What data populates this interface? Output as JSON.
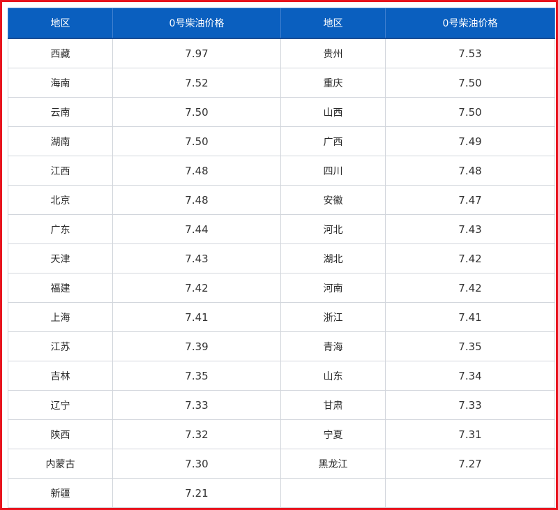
{
  "header": {
    "region_label": "地区",
    "price_label": "0号柴油价格"
  },
  "rows": [
    {
      "left": {
        "region": "西藏",
        "price": "7.97"
      },
      "right": {
        "region": "贵州",
        "price": "7.53"
      }
    },
    {
      "left": {
        "region": "海南",
        "price": "7.52"
      },
      "right": {
        "region": "重庆",
        "price": "7.50"
      }
    },
    {
      "left": {
        "region": "云南",
        "price": "7.50"
      },
      "right": {
        "region": "山西",
        "price": "7.50"
      }
    },
    {
      "left": {
        "region": "湖南",
        "price": "7.50"
      },
      "right": {
        "region": "广西",
        "price": "7.49"
      }
    },
    {
      "left": {
        "region": "江西",
        "price": "7.48"
      },
      "right": {
        "region": "四川",
        "price": "7.48"
      }
    },
    {
      "left": {
        "region": "北京",
        "price": "7.48"
      },
      "right": {
        "region": "安徽",
        "price": "7.47"
      }
    },
    {
      "left": {
        "region": "广东",
        "price": "7.44"
      },
      "right": {
        "region": "河北",
        "price": "7.43"
      }
    },
    {
      "left": {
        "region": "天津",
        "price": "7.43"
      },
      "right": {
        "region": "湖北",
        "price": "7.42"
      }
    },
    {
      "left": {
        "region": "福建",
        "price": "7.42"
      },
      "right": {
        "region": "河南",
        "price": "7.42"
      }
    },
    {
      "left": {
        "region": "上海",
        "price": "7.41"
      },
      "right": {
        "region": "浙江",
        "price": "7.41"
      }
    },
    {
      "left": {
        "region": "江苏",
        "price": "7.39"
      },
      "right": {
        "region": "青海",
        "price": "7.35"
      }
    },
    {
      "left": {
        "region": "吉林",
        "price": "7.35"
      },
      "right": {
        "region": "山东",
        "price": "7.34"
      }
    },
    {
      "left": {
        "region": "辽宁",
        "price": "7.33"
      },
      "right": {
        "region": "甘肃",
        "price": "7.33"
      }
    },
    {
      "left": {
        "region": "陕西",
        "price": "7.32"
      },
      "right": {
        "region": "宁夏",
        "price": "7.31"
      }
    },
    {
      "left": {
        "region": "内蒙古",
        "price": "7.30"
      },
      "right": {
        "region": "黑龙江",
        "price": "7.27"
      }
    },
    {
      "left": {
        "region": "新疆",
        "price": "7.21"
      },
      "right": {
        "region": "",
        "price": ""
      }
    }
  ],
  "colors": {
    "frame_border": "#e8141e",
    "header_bg": "#0a5fbf",
    "header_text": "#ffffff",
    "cell_border": "#d2d6dc"
  }
}
